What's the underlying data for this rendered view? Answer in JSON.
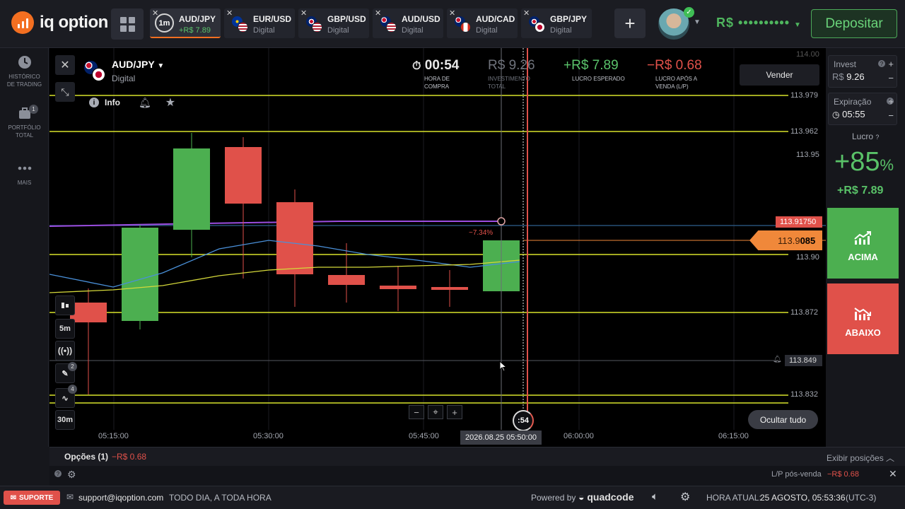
{
  "brand": {
    "logo_text": "iq option"
  },
  "tabs": [
    {
      "name": "AUD/JPY",
      "sub": "+R$ 7.89",
      "timeframe": "1m",
      "active": true
    },
    {
      "name": "EUR/USD",
      "sub": "Digital"
    },
    {
      "name": "GBP/USD",
      "sub": "Digital"
    },
    {
      "name": "AUD/USD",
      "sub": "Digital"
    },
    {
      "name": "AUD/CAD",
      "sub": "Digital"
    },
    {
      "name": "GBP/JPY",
      "sub": "Digital"
    }
  ],
  "header": {
    "balance": "R$ ••••••••••",
    "deposit_label": "Depositar"
  },
  "sidebar": {
    "items": [
      {
        "label_1": "HISTÓRICO",
        "label_2": "DE TRADING"
      },
      {
        "label_1": "PORTFÓLIO",
        "label_2": "TOTAL",
        "badge": "1"
      },
      {
        "label_1": "MAIS",
        "label_2": ""
      }
    ]
  },
  "asset": {
    "name": "AUD/JPY",
    "type": "Digital",
    "info_label": "Info"
  },
  "stats": {
    "timer": "00:54",
    "timer_label_1": "HORA DE",
    "timer_label_2": "COMPRA",
    "investment": "R$ 9.26",
    "investment_label_1": "INVESTIMENTO",
    "investment_label_2": "TOTAL",
    "expected_profit": "+R$ 7.89",
    "expected_profit_label": "LUCRO ESPERADO",
    "after_sale": "−R$ 0.68",
    "after_sale_label_1": "LUCRO APÓS A",
    "after_sale_label_2": "VENDA (L/P)"
  },
  "sell_label": "Vender",
  "chart": {
    "price_axis": [
      "114.00",
      "113.979",
      "113.962",
      "113.95",
      "113.90",
      "113.872",
      "113.849",
      "113.832"
    ],
    "current_price_main": "113.9",
    "current_price_bold": "085",
    "entry_price": "113.91750",
    "alert_price": "113.849",
    "trade_change": "−7.34%",
    "time_axis": [
      "05:15:00",
      "05:30:00",
      "05:45:00",
      "06:00:00",
      "06:15:00"
    ],
    "cursor_date": "2026.08.25 05:50:00",
    "expiry_countdown": ":54",
    "hide_all_label": "Ocultar tudo",
    "tool_timeframes": [
      "5m",
      "30m"
    ],
    "tool_badges": [
      "2",
      "4"
    ],
    "colors": {
      "up": "#4caf50",
      "down": "#e0514a",
      "level_line": "#d7e32a",
      "ma_blue": "#4a90d9",
      "ma_yellow": "#d4d83a",
      "entry_line": "#9b4de0"
    }
  },
  "right_panel": {
    "invest_label": "Invest",
    "invest_currency": "R$",
    "invest_value": "9.26",
    "expiry_label": "Expiração",
    "expiry_value": "05:55",
    "profit_label": "Lucro",
    "profit_pct": "+85",
    "profit_pct_sign": "%",
    "profit_value": "+R$ 7.89",
    "call_label": "ACIMA",
    "put_label": "ABAIXO"
  },
  "positions": {
    "label": "Opções",
    "count": "(1)",
    "value": "−R$ 0.68",
    "show_label": "Exibir posições",
    "lp_label": "L/P pós-venda",
    "lp_value": "−R$ 0.68"
  },
  "footer": {
    "support_label": "SUPORTE",
    "email": "support@iqoption.com",
    "hours": "TODO DIA, A TODA HORA",
    "powered_by": "Powered by",
    "powered_brand": "quadcode",
    "time_label": "HORA ATUAL:",
    "time_value": "25 AGOSTO, 05:53:36",
    "timezone": "(UTC-3)"
  }
}
